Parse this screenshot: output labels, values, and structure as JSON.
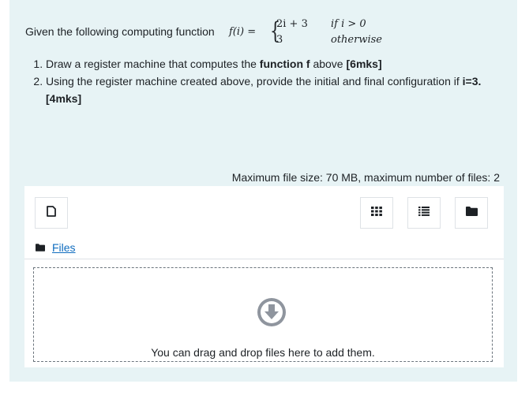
{
  "question": {
    "intro": "Given the following computing function",
    "function": {
      "name": "f(i) =",
      "case1_expr": "2i + 3",
      "case1_cond": "if i > 0",
      "case2_expr": "3",
      "case2_cond": "otherwise"
    },
    "tasks": [
      {
        "before": "Draw a register machine that computes the ",
        "bold": "function f",
        "after": " above ",
        "marks": "[6mks]"
      },
      {
        "before": "Using the register machine created above, provide the initial and final configuration if ",
        "bold": "i=3.",
        "after": " ",
        "marks": "[4mks]"
      }
    ]
  },
  "upload": {
    "max_info": "Maximum file size: 70 MB, maximum number of files: 2",
    "files_label": "Files",
    "drop_text": "You can drag and drop files here to add them."
  },
  "icons": {
    "add_file": "file-icon",
    "view_grid": "grid-icon",
    "view_list": "list-icon",
    "view_tree": "folder-icon",
    "folder": "folder-icon",
    "drop": "arrow-down-circle-icon"
  },
  "colors": {
    "panel_bg": "#e7f3f5",
    "link": "#0f6cbf",
    "icon_dark": "#1d2125",
    "drop_icon": "#8f959e"
  }
}
